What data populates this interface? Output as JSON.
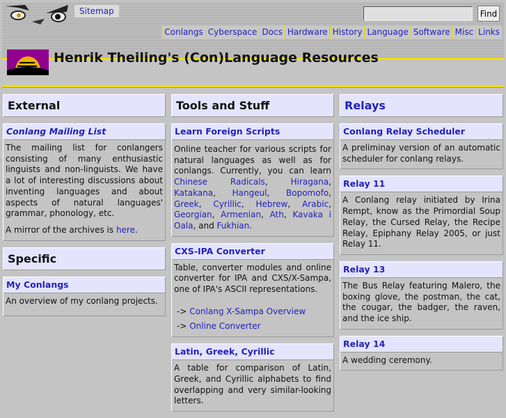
{
  "header": {
    "sitemap": "Sitemap",
    "search_value": "",
    "find": "Find",
    "nav": [
      "Conlangs",
      "Cyberspace",
      "Docs",
      "Hardware",
      "History",
      "Language",
      "Software",
      "Misc",
      "Links"
    ],
    "title": "Henrik Theiling's (Con)Language Resources"
  },
  "external": {
    "title": "External",
    "box": {
      "title": "Conlang Mailing List",
      "body": "The mailing list for conlangers consisting of many enthusiastic linguists and non-linguists. We have a lot of interesting discussions about inventing languages and about aspects of natural languages' grammar, phonology, etc.",
      "mirror_text": "A mirror of the archives is ",
      "mirror_link": "here",
      "mirror_end": "."
    }
  },
  "specific": {
    "title": "Specific",
    "box": {
      "title": "My Conlangs",
      "body": "An overview of my conlang projects."
    }
  },
  "tools": {
    "title": "Tools and Stuff",
    "scripts": {
      "title": "Learn Foreign Scripts",
      "body": "Online teacher for various scripts for natural languages as well as for conlangs. Currently, you can learn ",
      "links": [
        "Chinese Radicals",
        "Hiragana",
        "Katakana",
        "Hangeul",
        "Bopomofo",
        "Greek",
        "Cyrillic",
        "Hebrew",
        "Arabic",
        "Georgian",
        "Armenian",
        "Ath",
        "Kavaka i Oala"
      ],
      "and": ", and ",
      "last": "Fukhian",
      "end": "."
    },
    "cxs": {
      "title": "CXS-IPA Converter",
      "body": "Table, converter modules and online converter for IPA and CXS/X-Sampa, one of IPA's ASCII representations.",
      "arrow": "->",
      "link1": "Conlang X-Sampa Overview",
      "link2": "Online Converter"
    },
    "lgc": {
      "title": "Latin, Greek, Cyrillic",
      "body": "A table for comparison of Latin, Greek, and Cyrillic alphabets to find overlapping and very similar-looking letters."
    }
  },
  "relays": {
    "title": "Relays",
    "boxes": [
      {
        "title": "Conlang Relay Scheduler",
        "body": "A preliminay version of an automatic scheduler for conlang relays."
      },
      {
        "title": "Relay 11",
        "body": "A Conlang relay initiated by Irina Rempt, know as the Primordial Soup Relay, the Cursed Relay, the Recipe Relay, Epiphany Relay 2005, or just Relay 11."
      },
      {
        "title": "Relay 13",
        "body": "The Bus Relay featuring Malero, the boxing glove, the postman, the cat, the cougar, the badger, the raven, and the ice ship."
      },
      {
        "title": "Relay 14",
        "body": "A wedding ceremony."
      }
    ]
  }
}
